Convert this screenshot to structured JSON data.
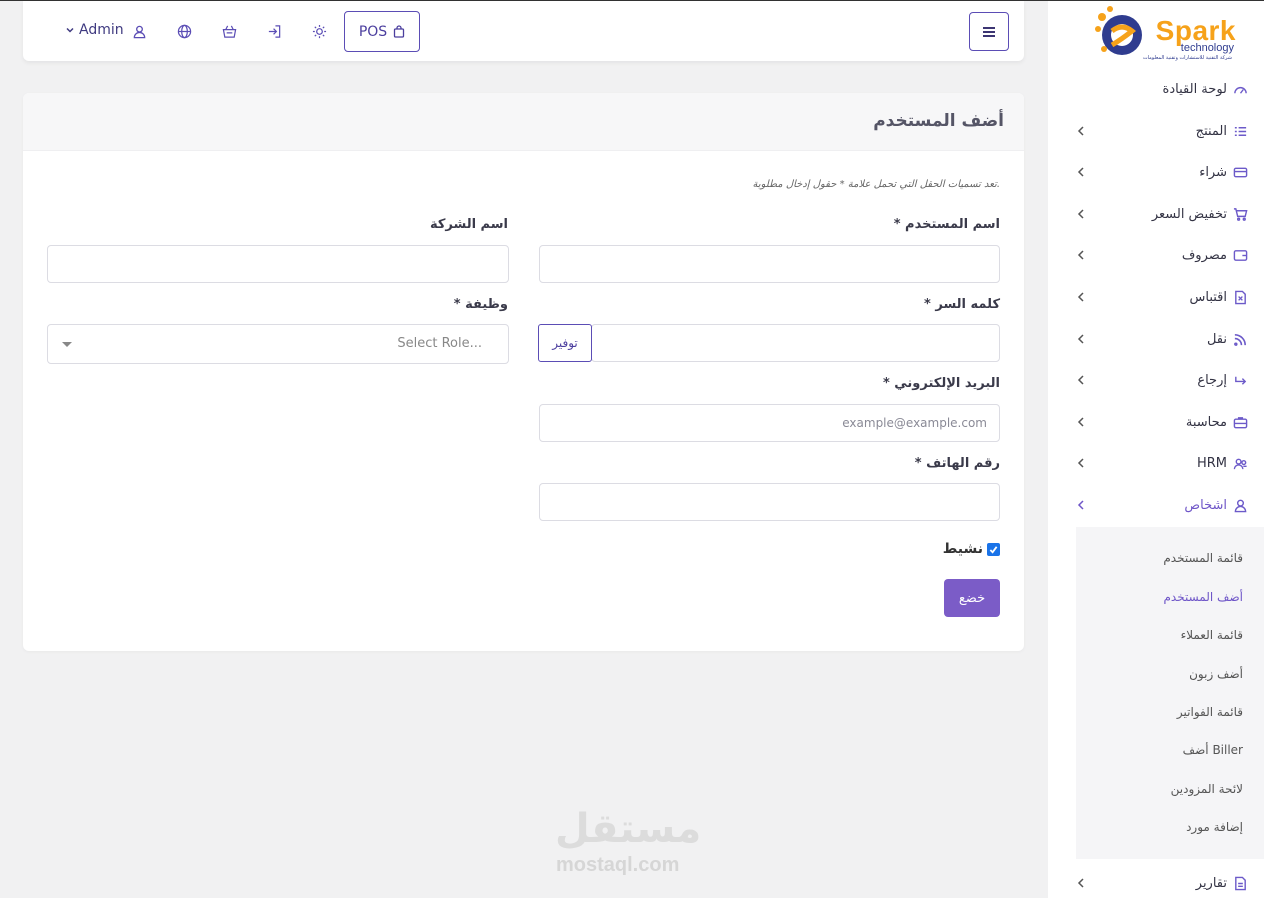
{
  "topbar": {
    "admin_label": "Admin",
    "pos_label": "POS"
  },
  "brand": {
    "name": "Spark",
    "sub": "technology",
    "tagline": "شركة التقنية للاستشارات وتقنية المعلومات"
  },
  "sidebar": {
    "items": [
      {
        "label": "لوحة القيادة",
        "icon": "dashboard-icon"
      },
      {
        "label": "المنتج",
        "icon": "list-icon"
      },
      {
        "label": "شراء",
        "icon": "card-icon"
      },
      {
        "label": "تخفيض السعر",
        "icon": "cart-icon"
      },
      {
        "label": "مصروف",
        "icon": "wallet-icon"
      },
      {
        "label": "اقتباس",
        "icon": "document-icon"
      },
      {
        "label": "نقل",
        "icon": "rss-icon"
      },
      {
        "label": "إرجاع",
        "icon": "return-icon"
      },
      {
        "label": "محاسبة",
        "icon": "briefcase-icon"
      },
      {
        "label": "HRM",
        "icon": "users-icon"
      },
      {
        "label": "اشخاص",
        "icon": "user-icon"
      },
      {
        "label": "تقارير",
        "icon": "report-icon"
      }
    ],
    "submenu": [
      "قائمة المستخدم",
      "أضف المستخدم",
      "قائمة العملاء",
      "أضف زبون",
      "قائمة الفواتير",
      "أضف Biller",
      "لائحة المزودين",
      "إضافة مورد"
    ]
  },
  "form": {
    "title": "أضف المستخدم",
    "note": "تعد تسميات الحقل التي تحمل علامة * حقول إدخال مطلوبة.",
    "username_label": "اسم المستخدم *",
    "company_label": "اسم الشركة",
    "password_label": "كلمه السر *",
    "role_label": "وظيفة *",
    "role_placeholder": "Select Role...",
    "generate_label": "توفير",
    "email_label": "البريد الإلكتروني *",
    "email_placeholder": "example@example.com",
    "phone_label": "رقم الهاتف *",
    "active_label": "نشيط",
    "active_checked": true,
    "submit_label": "خضع"
  },
  "watermark": {
    "arabic": "مستقل",
    "latin": "mostaql.com"
  },
  "colors": {
    "accent": "#7b5cc7",
    "checkbox": "#1a73e8"
  }
}
